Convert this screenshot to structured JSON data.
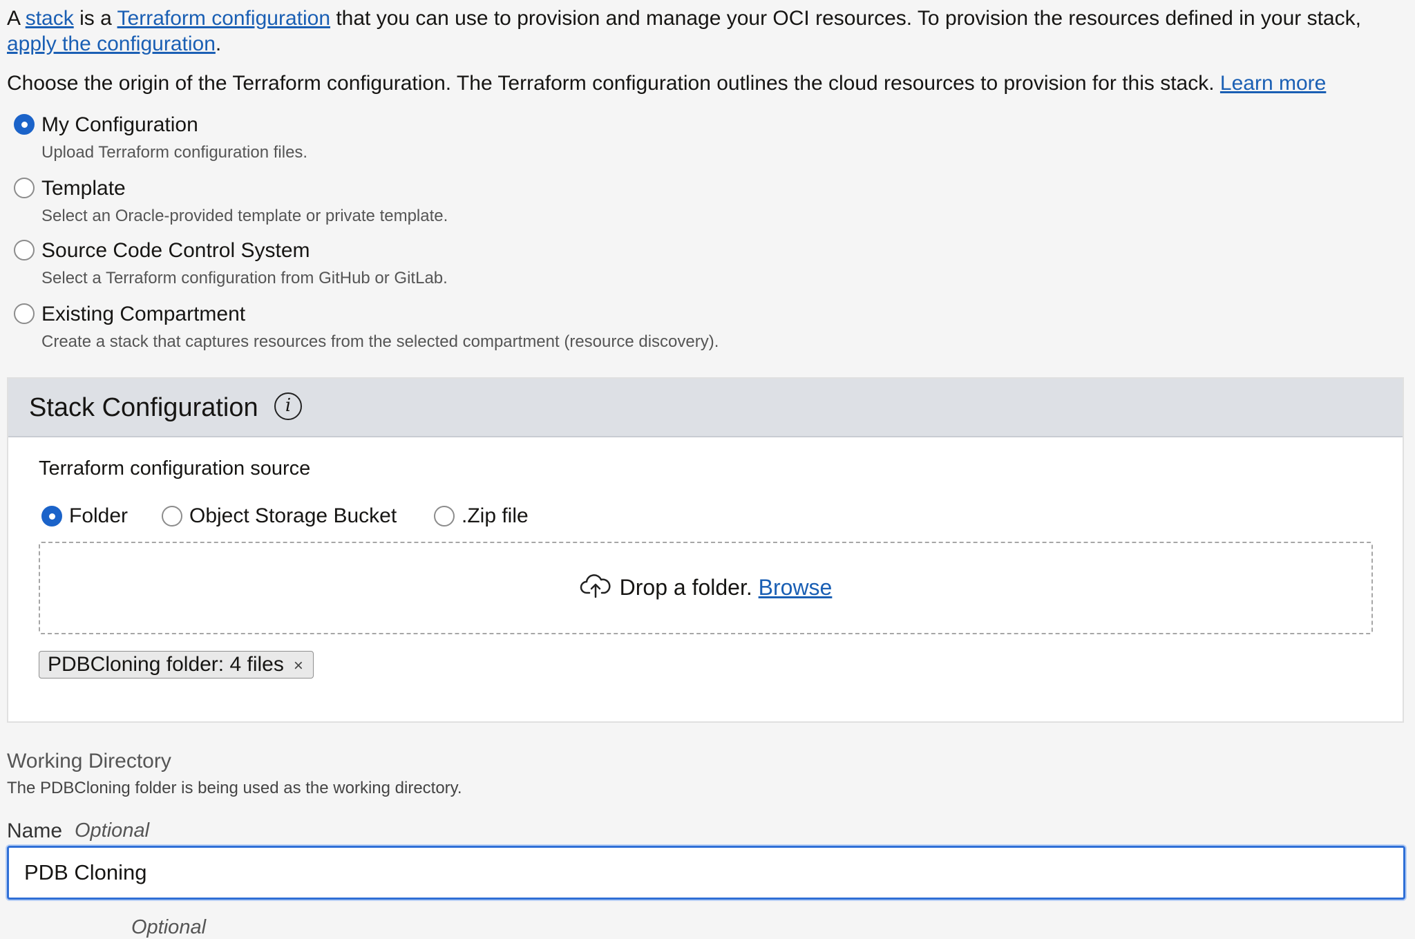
{
  "intro": {
    "t1": "A ",
    "stack_link": "stack",
    "t2": " is a ",
    "terraform_link": "Terraform configuration",
    "t3": " that you can use to provision and manage your OCI resources. To provision the resources defined in your stack, ",
    "apply_link": "apply the configuration",
    "t4": "."
  },
  "origin": {
    "text": "Choose the origin of the Terraform configuration. The Terraform configuration outlines the cloud resources to provision for this stack. ",
    "learn_more": "Learn more",
    "options": [
      {
        "label": "My Configuration",
        "desc": "Upload Terraform configuration files.",
        "selected": true
      },
      {
        "label": "Template",
        "desc": "Select an Oracle-provided template or private template.",
        "selected": false
      },
      {
        "label": "Source Code Control System",
        "desc": "Select a Terraform configuration from GitHub or GitLab.",
        "selected": false
      },
      {
        "label": "Existing Compartment",
        "desc": "Create a stack that captures resources from the selected compartment (resource discovery).",
        "selected": false
      }
    ]
  },
  "stack_config": {
    "title": "Stack Configuration",
    "info_icon": "i",
    "source_label": "Terraform configuration source",
    "source_options": [
      {
        "label": "Folder",
        "selected": true
      },
      {
        "label": "Object Storage Bucket",
        "selected": false
      },
      {
        "label": ".Zip file",
        "selected": false
      }
    ],
    "drop_text": "Drop a folder.",
    "browse": "Browse",
    "chip": "PDBCloning folder: 4 files",
    "chip_close": "×"
  },
  "working_directory": {
    "title": "Working Directory",
    "desc": "The PDBCloning folder is being used as the working directory."
  },
  "name_field": {
    "label": "Name",
    "optional": "Optional",
    "value": "PDB Cloning"
  },
  "next_field": {
    "optional": "Optional"
  },
  "colors": {
    "accent": "#1b63c9",
    "link": "#1a5fb4",
    "panel_header": "#dde0e5",
    "page_bg": "#f5f5f5"
  }
}
